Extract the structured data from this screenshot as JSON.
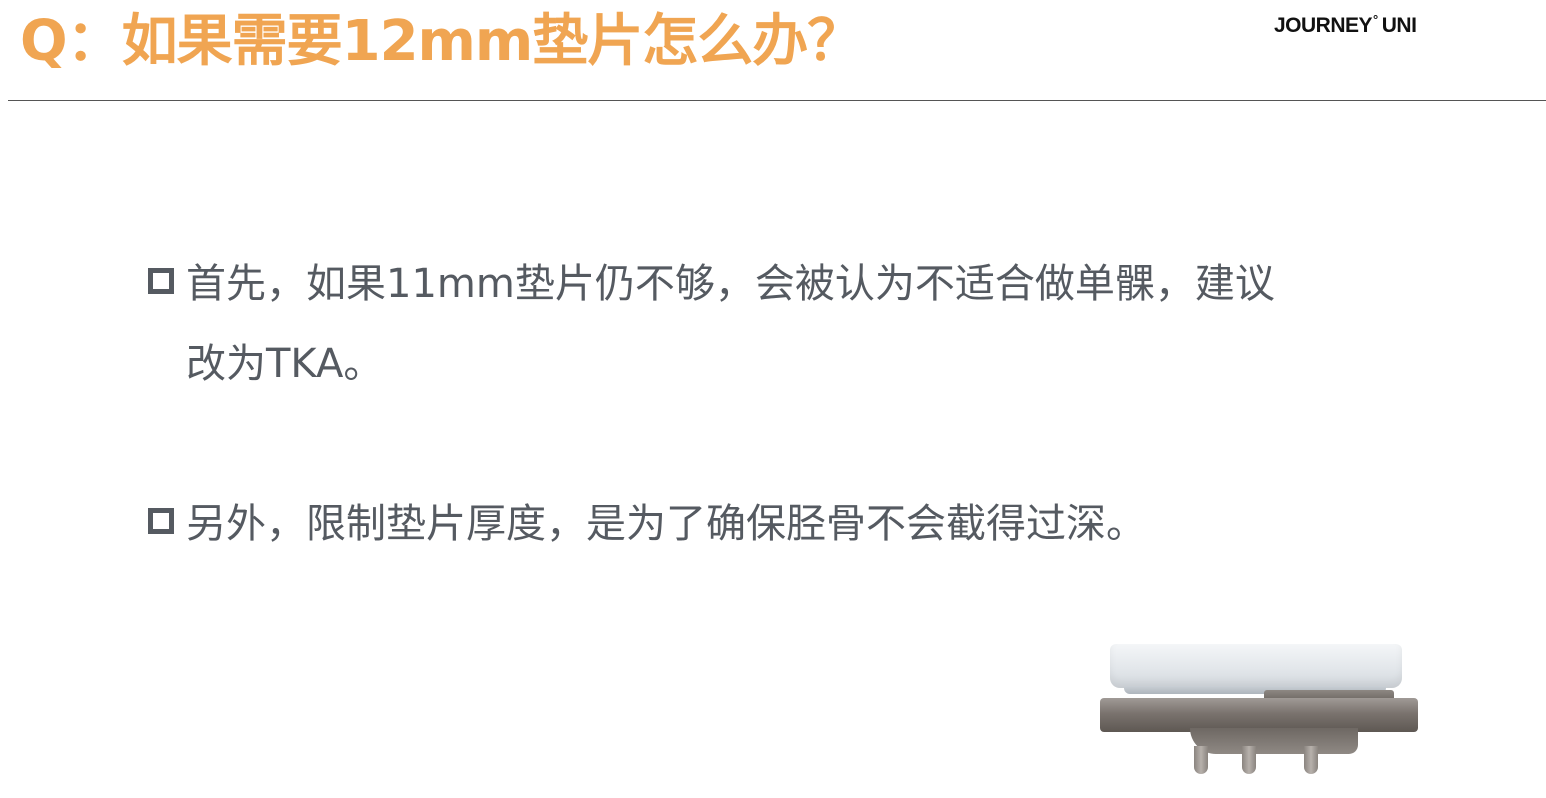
{
  "header": {
    "title": "Q：如果需要12mm垫片怎么办？",
    "brand_left": "JOURNEY",
    "brand_mark": "°",
    "brand_right": "UNI"
  },
  "bullets": [
    {
      "text": "首先，如果11mm垫片仍不够，会被认为不适合做单髁，建议\n改为TKA。"
    },
    {
      "text": "另外，限制垫片厚度，是为了确保胫骨不会截得过深。"
    }
  ],
  "figure": {
    "icon": "tibial-tray-with-insert-image"
  },
  "colors": {
    "title": "#f0a552",
    "body_text": "#555a61",
    "rule": "#555555"
  }
}
